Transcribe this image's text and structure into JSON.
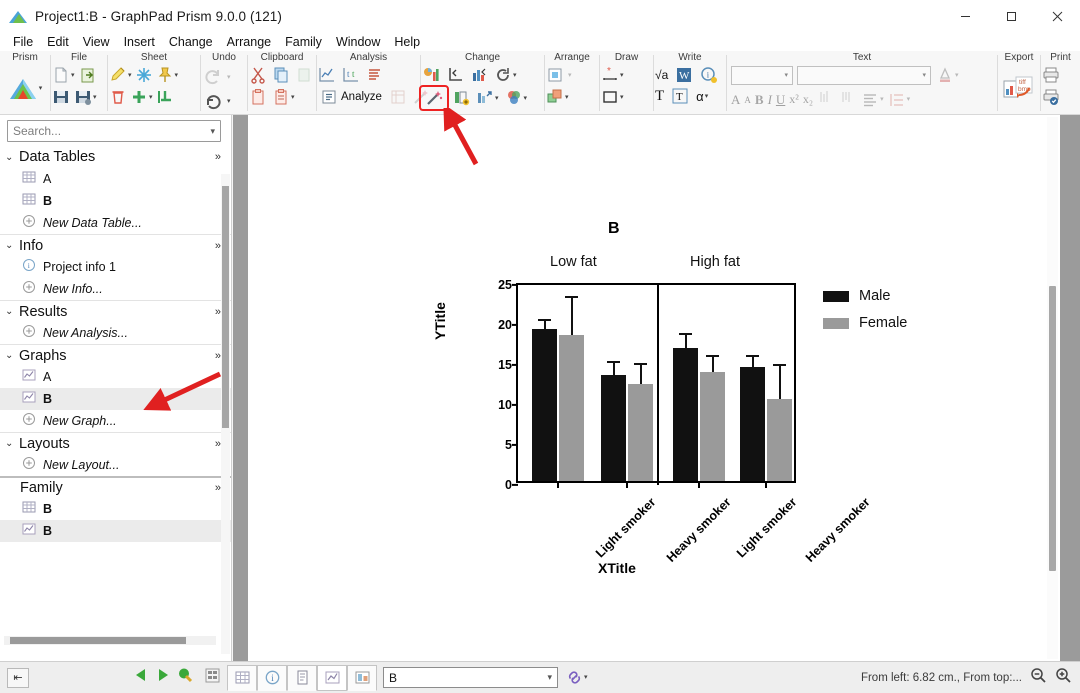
{
  "window": {
    "title": "Project1:B - GraphPad Prism 9.0.0 (121)",
    "minimize": "—",
    "maximize": "☐",
    "close": "✕"
  },
  "menubar": {
    "items": [
      "File",
      "Edit",
      "View",
      "Insert",
      "Change",
      "Arrange",
      "Family",
      "Window",
      "Help"
    ]
  },
  "ribbon": {
    "groups": [
      {
        "name": "Prism",
        "items": [
          "prism-logo-icon"
        ]
      },
      {
        "name": "File",
        "items": [
          "new-file-icon",
          "open-file-icon",
          "save-icon",
          "save-as-icon"
        ]
      },
      {
        "name": "Sheet",
        "items": [
          "rename-sheet-icon",
          "freeze-icon",
          "pin-icon",
          "delete-sheet-icon",
          "new-sheet-icon",
          "duplicate-sheet-icon"
        ]
      },
      {
        "name": "Undo",
        "items": [
          "redo-icon",
          "undo-icon"
        ]
      },
      {
        "name": "Clipboard",
        "items": [
          "cut-icon",
          "copy-icon",
          "paste-special-icon",
          "paste-icon",
          "paste-menu-icon"
        ]
      },
      {
        "name": "Analysis",
        "items": [
          "analysis-chart-icon",
          "t-test-icon",
          "summary-icon",
          "analyze-button",
          "analyze-table-icon",
          "wand-analysis-icon"
        ]
      },
      {
        "name": "Change",
        "items": [
          "change-graph-type-icon",
          "axis-icon",
          "format-graph-icon",
          "refresh-icon",
          "magic-wand-icon",
          "add-data-set-icon",
          "graph-export-icon",
          "color-scheme-icon"
        ]
      },
      {
        "name": "Arrange",
        "items": [
          "bring-front-icon",
          "group-icon"
        ]
      },
      {
        "name": "Draw",
        "items": [
          "line-tool-icon",
          "shape-tool-icon"
        ]
      },
      {
        "name": "Write",
        "items": [
          "equation-icon",
          "word-icon",
          "info-icon",
          "text-big-icon",
          "text-box-icon",
          "greek-icon"
        ]
      },
      {
        "name": "Text",
        "items": [
          "font-select",
          "font-name-input",
          "font-color-icon",
          "grow-font-icon",
          "shrink-font-icon",
          "bold-icon",
          "italic-icon",
          "underline-icon",
          "superscript-icon",
          "subscript-icon",
          "sub-align-icon",
          "sup-align-icon",
          "align-icon",
          "line-spacing-icon"
        ]
      },
      {
        "name": "Export",
        "items": [
          "export-tiff-bmp-icon"
        ]
      },
      {
        "name": "Print",
        "items": [
          "print-icon",
          "print-preview-icon"
        ]
      }
    ],
    "analyze_label": "Analyze",
    "font_name_value": "",
    "bold_label": "B",
    "italic_label": "I",
    "underline_label": "U",
    "superscript_label": "x²",
    "subscript_label": "x₂",
    "greek_label": "α",
    "sqrt_label": "√a",
    "word_label": "W",
    "text_t_label": "T",
    "tiff_label": "tiff",
    "bmp_label": "bmp"
  },
  "navigator": {
    "search_placeholder": "Search...",
    "sections": [
      {
        "title": "Data Tables",
        "chevron": "⌄",
        "more": "»",
        "rows": [
          {
            "label": "A",
            "icon": "table-icon",
            "bold": false,
            "italic": false,
            "selected": false
          },
          {
            "label": "B",
            "icon": "table-icon",
            "bold": true,
            "italic": false,
            "selected": false
          },
          {
            "label": "New Data Table...",
            "icon": "plus-circle-icon",
            "bold": false,
            "italic": true,
            "selected": false
          }
        ]
      },
      {
        "title": "Info",
        "chevron": "⌄",
        "more": "»",
        "rows": [
          {
            "label": "Project info 1",
            "icon": "info-circle-icon",
            "bold": false,
            "italic": false,
            "selected": false
          },
          {
            "label": "New Info...",
            "icon": "plus-circle-icon",
            "bold": false,
            "italic": true,
            "selected": false
          }
        ]
      },
      {
        "title": "Results",
        "chevron": "⌄",
        "more": "»",
        "rows": [
          {
            "label": "New Analysis...",
            "icon": "plus-circle-icon",
            "bold": false,
            "italic": true,
            "selected": false
          }
        ]
      },
      {
        "title": "Graphs",
        "chevron": "⌄",
        "more": "»",
        "rows": [
          {
            "label": "A",
            "icon": "graph-icon",
            "bold": false,
            "italic": false,
            "selected": false
          },
          {
            "label": "B",
            "icon": "graph-icon",
            "bold": true,
            "italic": false,
            "selected": true
          },
          {
            "label": "New Graph...",
            "icon": "plus-circle-icon",
            "bold": false,
            "italic": true,
            "selected": false
          }
        ]
      },
      {
        "title": "Layouts",
        "chevron": "⌄",
        "more": "»",
        "rows": [
          {
            "label": "New Layout...",
            "icon": "plus-circle-icon",
            "bold": false,
            "italic": true,
            "selected": false
          }
        ]
      }
    ],
    "family": {
      "title": "Family",
      "more": "»",
      "rows": [
        {
          "label": "B",
          "icon": "table-icon",
          "bold": true,
          "italic": false,
          "selected": false
        },
        {
          "label": "B",
          "icon": "graph-icon",
          "bold": true,
          "italic": false,
          "selected": true
        }
      ]
    }
  },
  "statusbar": {
    "collapse_label": "⇤",
    "prev_label": "◀",
    "next_label": "▶",
    "sheet_select_value": "B",
    "chevron": "⌄",
    "coordinates": "From left: 6.82 cm., From top:...",
    "zoom_out_icon": "zoom-out-icon",
    "zoom_in_icon": "zoom-in-icon",
    "tabs": [
      "sheet-grid-icon",
      "data-table-icon",
      "info-icon",
      "results-icon",
      "graph-icon",
      "layout-icon"
    ]
  },
  "chart_data": {
    "type": "bar",
    "title": "B",
    "xlabel": "XTitle",
    "ylabel": "YTitle",
    "ylim": [
      0,
      25
    ],
    "yticks": [
      0,
      5,
      10,
      15,
      20,
      25
    ],
    "grid": false,
    "legend_position": "right",
    "group_labels": [
      "Low fat",
      "High fat"
    ],
    "categories": [
      "Light smoker",
      "Heavy smoker",
      "Light smoker",
      "Heavy smoker"
    ],
    "series": [
      {
        "name": "Male",
        "color": "#111111",
        "values": [
          19.0,
          13.3,
          16.6,
          14.2
        ],
        "errors": [
          1.0,
          1.5,
          1.6,
          1.3
        ]
      },
      {
        "name": "Female",
        "color": "#9a9a9a",
        "values": [
          18.3,
          12.1,
          13.6,
          10.2
        ],
        "errors": [
          4.6,
          2.4,
          1.9,
          4.2
        ]
      }
    ]
  },
  "annotations": {
    "toolbar_highlight": "magic-wand-icon",
    "arrow_color": "#e02020",
    "arrows": [
      "toolbar-arrow",
      "sidebar-graph-b-arrow"
    ]
  }
}
